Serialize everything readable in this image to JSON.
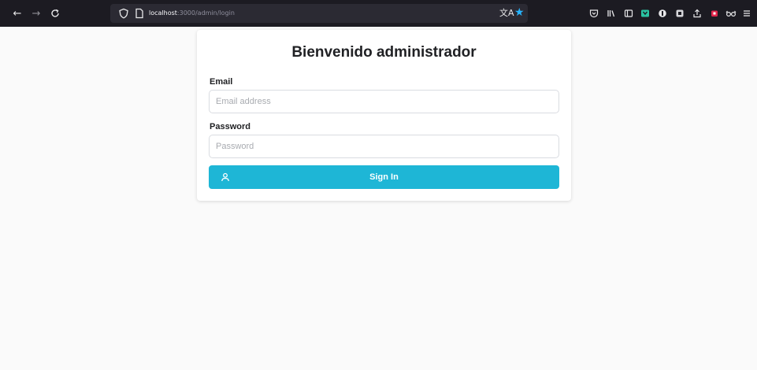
{
  "browser": {
    "url_host": "localhost",
    "url_path": ":3000/admin/login",
    "nav_icons": [
      "back-arrow-icon",
      "forward-arrow-icon",
      "reload-icon"
    ],
    "toolbar_icons": [
      "pocket-icon",
      "library-icon",
      "sidebar-icon",
      "extension-icon",
      "extension-icon",
      "extension-icon",
      "share-icon",
      "ublock-icon",
      "glasses-icon",
      "menu-icon"
    ],
    "accent_color": "#27b5ff"
  },
  "login": {
    "title": "Bienvenido administrador",
    "email_label": "Email",
    "email_placeholder": "Email address",
    "email_value": "",
    "password_label": "Password",
    "password_placeholder": "Password",
    "password_value": "",
    "signin_label": "Sign In",
    "signin_icon": "user-icon",
    "button_color": "#1eb6d6"
  }
}
